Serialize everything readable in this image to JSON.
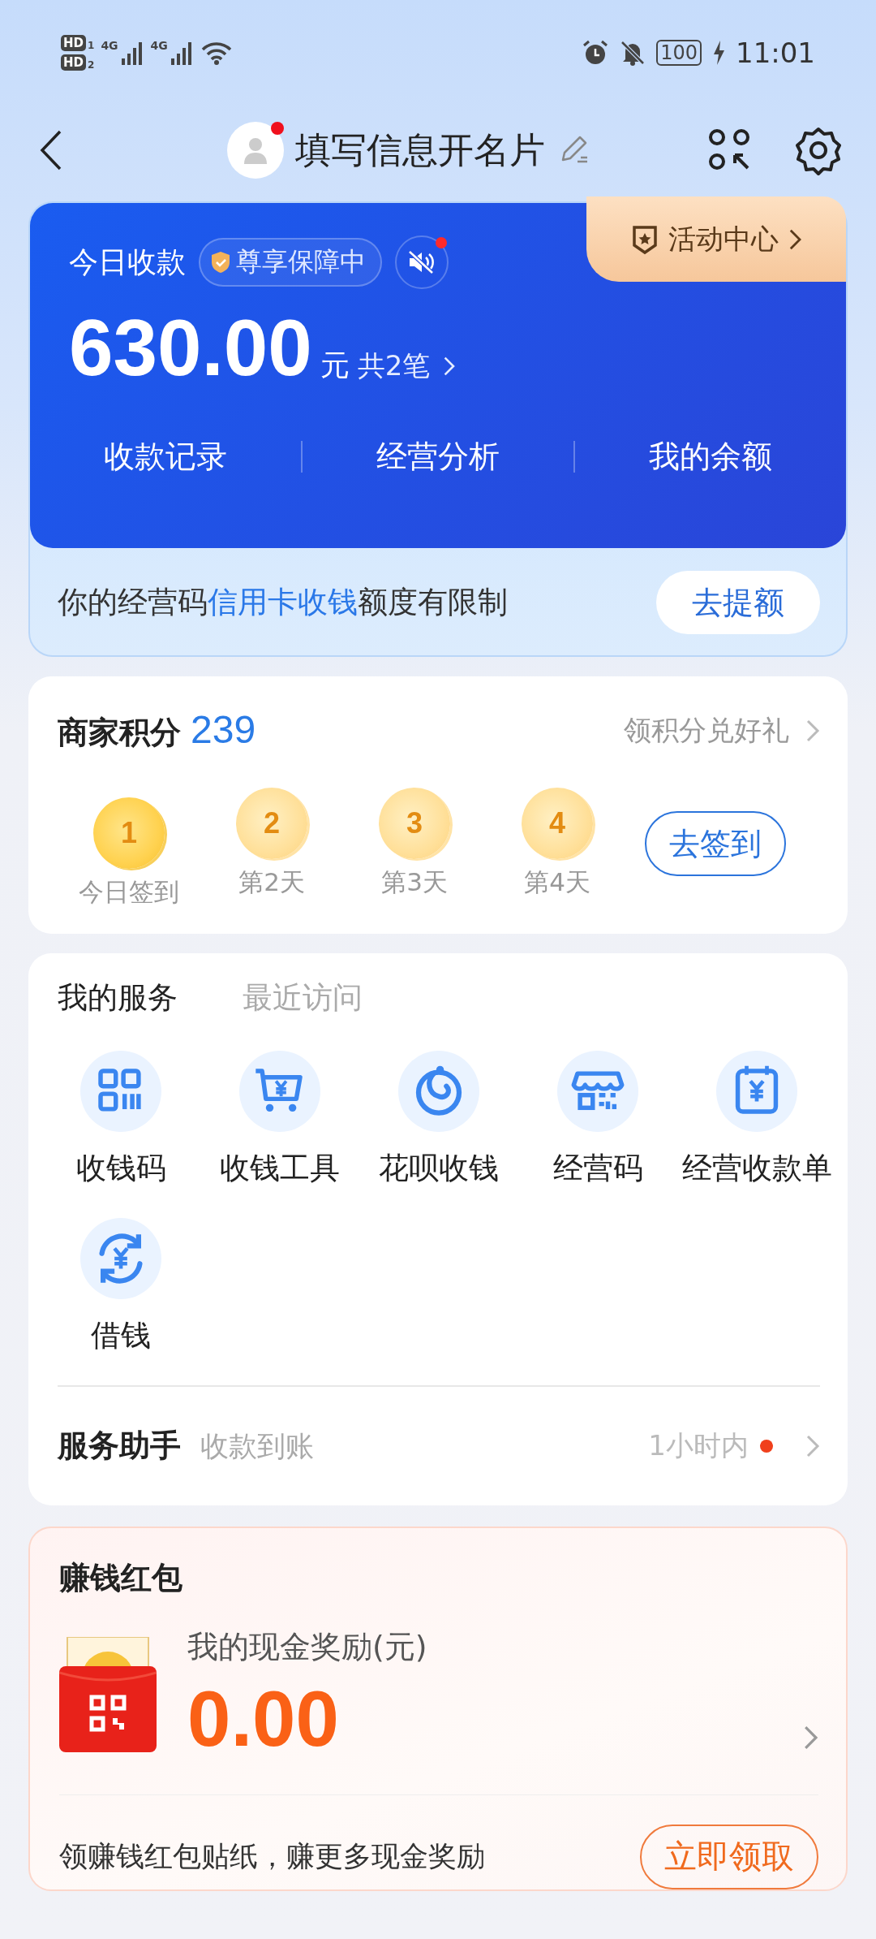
{
  "status_bar": {
    "sims": [
      {
        "label": "HD",
        "slot": "1"
      },
      {
        "label": "HD",
        "slot": "2"
      }
    ],
    "networks": [
      "4G",
      "4G"
    ],
    "battery": "100",
    "time": "11:01"
  },
  "header": {
    "title": "填写信息开名片",
    "avatar_notification": true
  },
  "today_card": {
    "title": "今日收款",
    "badge": "尊享保障中",
    "sound_notification": true,
    "activity_tab": "活动中心",
    "amount": "630.00",
    "unit": "元",
    "count": "共2笔",
    "links": [
      "收款记录",
      "经营分析",
      "我的余额"
    ],
    "notice": [
      {
        "text": "你的经营码",
        "highlight": false
      },
      {
        "text": "信用卡收钱",
        "highlight": true
      },
      {
        "text": "额度有限制",
        "highlight": false
      }
    ],
    "notice_button": "去提额"
  },
  "points": {
    "title": "商家积分",
    "value": "239",
    "link": "领积分兑好礼",
    "days": [
      {
        "number": "1",
        "label": "今日签到",
        "selected": true
      },
      {
        "number": "2",
        "label": "第2天",
        "selected": false
      },
      {
        "number": "3",
        "label": "第3天",
        "selected": false
      },
      {
        "number": "4",
        "label": "第4天",
        "selected": false
      }
    ],
    "button": "去签到"
  },
  "services": {
    "tabs": [
      {
        "label": "我的服务",
        "selected": true
      },
      {
        "label": "最近访问",
        "selected": false
      }
    ],
    "items": [
      {
        "label": "收钱码",
        "kind": "qr"
      },
      {
        "label": "收钱工具",
        "kind": "cart"
      },
      {
        "label": "花呗收钱",
        "kind": "swirl"
      },
      {
        "label": "经营码",
        "kind": "shop"
      },
      {
        "label": "经营收款单",
        "kind": "bill"
      },
      {
        "label": "借钱",
        "kind": "exchange"
      }
    ],
    "assistant": {
      "title": "服务助手",
      "subtitle": "收款到账",
      "time": "1小时内",
      "unread": true
    }
  },
  "red_packet": {
    "title": "赚钱红包",
    "reward_label": "我的现金奖励(元)",
    "amount": "0.00",
    "promo": "领赚钱红包贴纸，赚更多现金奖励",
    "button": "立即领取"
  }
}
